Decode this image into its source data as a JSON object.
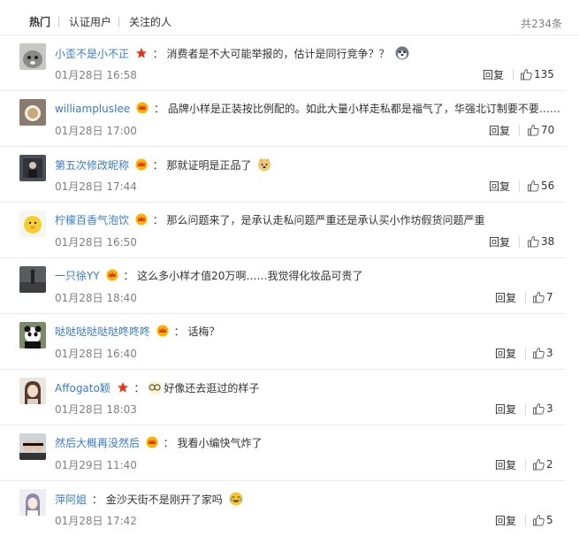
{
  "tabs": {
    "hot": "热门",
    "verified": "认证用户",
    "following": "关注的人",
    "total": "共234条"
  },
  "reply_label": "回复",
  "comments": [
    {
      "user": "小歪不是小不正",
      "text": "消费者是不大可能举报的，估计是同行竞争？？",
      "time": "01月28日 16:58",
      "likes": "135"
    },
    {
      "user": "williamplusIee",
      "text": "品牌小样是正装按比例配的。如此大量小样走私都是福气了，华强北订制要不要……",
      "time": "01月28日 17:00",
      "likes": "70"
    },
    {
      "user": "第五次修改昵称",
      "text": "那就证明是正品了",
      "time": "01月28日 17:44",
      "likes": "56"
    },
    {
      "user": "柠檬百香气泡饮",
      "text": "那么问题来了，是承认走私问题严重还是承认买小作坊假货问题严重",
      "time": "01月28日 16:50",
      "likes": "38"
    },
    {
      "user": "一只徐YY",
      "text": "这么多小样才值20万啊……我觉得化妆品可贵了",
      "time": "01月28日 18:40",
      "likes": "7"
    },
    {
      "user": "哒哒哒哒哒哒咚咚咚",
      "text": "话梅？",
      "time": "01月28日 16:40",
      "likes": "3"
    },
    {
      "user": "Affogato颖",
      "text": "好像还去逛过的样子",
      "time": "01月28日 18:03",
      "likes": "3"
    },
    {
      "user": "然后大概再没然后",
      "text": "我看小编快气炸了",
      "time": "01月29日 11:40",
      "likes": "2"
    },
    {
      "user": "萍阿姐",
      "text": "金沙天街不是刚开了家吗",
      "time": "01月28日 17:42",
      "likes": "5"
    }
  ],
  "colors": {
    "username": "#3a7bd0",
    "text": "#333333",
    "meta": "#808080",
    "border": "#eaeaea"
  }
}
